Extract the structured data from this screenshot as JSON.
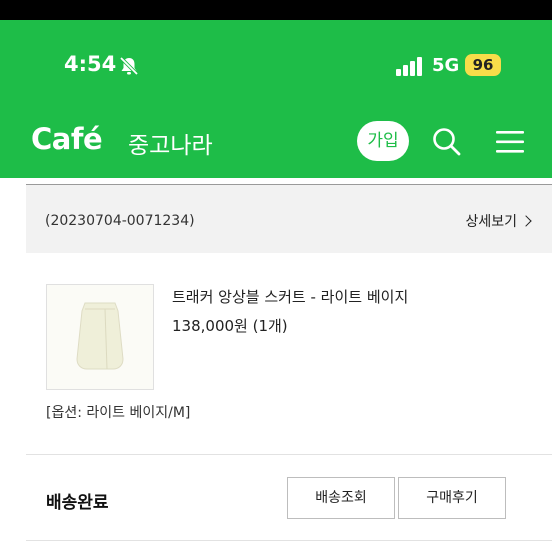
{
  "status_bar": {
    "time": "4:54",
    "network": "5G",
    "battery": "96"
  },
  "header": {
    "logo": "Café",
    "cafe_name": "중고나라",
    "join_label": "가입"
  },
  "order": {
    "number": "(20230704-0071234)",
    "detail_label": "상세보기"
  },
  "product": {
    "name": "트래커 앙상블 스커트 - 라이트 베이지",
    "price": "138,000원 (1개)",
    "option": "[옵션: 라이트 베이지/M]"
  },
  "delivery": {
    "status": "배송완료",
    "track_label": "배송조회",
    "review_label": "구매후기"
  },
  "colors": {
    "brand_green": "#1ebd48",
    "battery_yellow": "#f7dd4a"
  }
}
